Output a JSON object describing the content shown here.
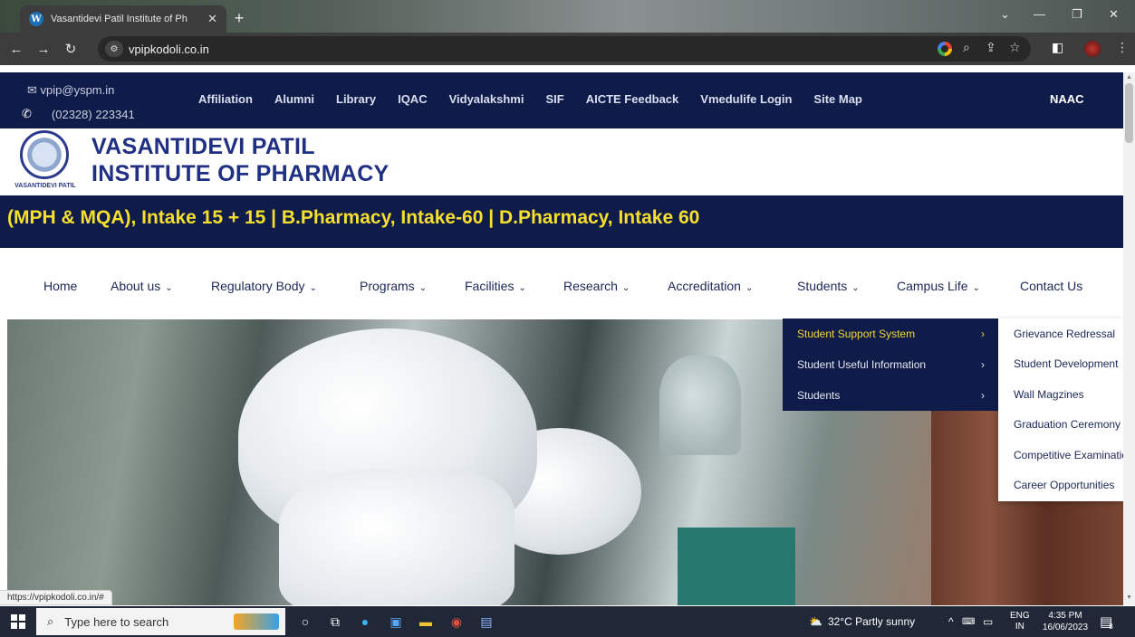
{
  "browser": {
    "tab_title": "Vasantidevi Patil Institute of Ph",
    "tab_close": "✕",
    "new_tab": "+",
    "url": "vpipkodoli.co.in",
    "back": "←",
    "forward": "→",
    "reload": "↻",
    "status_url": "https://vpipkodoli.co.in/#"
  },
  "topbar": {
    "email": "vpip@yspm.in",
    "phone": "(02328) 223341",
    "links": [
      "Affiliation",
      "Alumni",
      "Library",
      "IQAC",
      "Vidyalakshmi",
      "SIF",
      "AICTE Feedback",
      "Vmedulife Login",
      "Site Map"
    ],
    "naac": "NAAC"
  },
  "header": {
    "name_line1": "VASANTIDEVI PATIL",
    "name_line2": "INSTITUTE OF PHARMACY",
    "logo_text": "VASANTIDEVI PATIL"
  },
  "ticker": {
    "text": "(MPH & MQA), Intake 15 + 15 | B.Pharmacy, Intake-60 | D.Pharmacy, Intake 60"
  },
  "main_nav": {
    "items": [
      "Home",
      "About us",
      "Regulatory Body",
      "Programs",
      "Facilities",
      "Research",
      "Accreditation",
      "Students",
      "Campus Life",
      "Contact Us"
    ]
  },
  "students_menu": {
    "items": [
      "Student Support System",
      "Student Useful Information",
      "Students"
    ]
  },
  "support_submenu": {
    "items": [
      "Grievance Redressal",
      "Student Development",
      "Wall Magzines",
      "Graduation Ceremony",
      "Competitive Examinations",
      "Career Opportunities"
    ]
  },
  "taskbar": {
    "search_placeholder": "Type here to search",
    "weather": "32°C  Partly sunny",
    "lang1": "ENG",
    "lang2": "IN",
    "time": "4:35 PM",
    "date": "16/06/2023",
    "notif_count": "8"
  },
  "colors": {
    "navy": "#0f1c49",
    "accent_yellow": "#f7df2f",
    "brand_blue": "#1f2f83"
  }
}
